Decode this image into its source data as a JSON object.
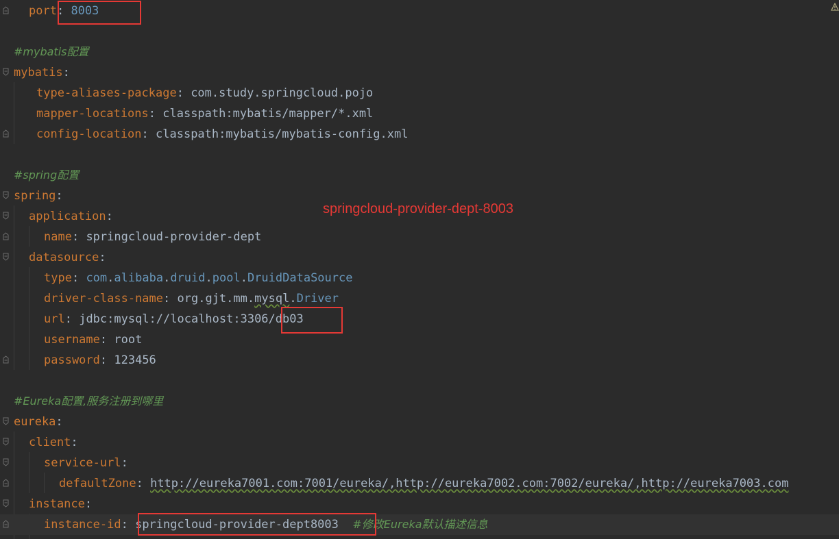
{
  "lines": [
    {
      "key": "port",
      "value": "8003"
    },
    {
      "comment": "#mybatis配置"
    },
    {
      "key": "mybatis"
    },
    {
      "key": "type-aliases-package",
      "value": "com.study.springcloud.pojo"
    },
    {
      "key": "mapper-locations",
      "value": "classpath:mybatis/mapper/*.xml"
    },
    {
      "key": "config-location",
      "value": "classpath:mybatis/mybatis-config.xml"
    },
    {
      "comment": "#spring配置"
    },
    {
      "key": "spring"
    },
    {
      "key": "application"
    },
    {
      "key": "name",
      "value": "springcloud-provider-dept"
    },
    {
      "key": "datasource"
    },
    {
      "key": "type",
      "value_parts": [
        "com",
        "alibaba",
        "druid",
        "pool",
        "DruidDataSource"
      ]
    },
    {
      "key": "driver-class-name",
      "value_parts": [
        "org",
        "gjt",
        "mm",
        "mysql",
        "Driver"
      ]
    },
    {
      "key": "url",
      "value": "jdbc:mysql://localhost:3306/db03"
    },
    {
      "key": "username",
      "value": "root"
    },
    {
      "key": "password",
      "value": "123456"
    },
    {
      "comment": "#Eureka配置,服务注册到哪里"
    },
    {
      "key": "eureka"
    },
    {
      "key": "client"
    },
    {
      "key": "service-url"
    },
    {
      "key": "defaultZone",
      "value": "http://eureka7001.com:7001/eureka/,http://eureka7002.com:7002/eureka/,http://eureka7003.com"
    },
    {
      "key": "instance"
    },
    {
      "key": "instance-id",
      "value": "springcloud-provider-dept8003",
      "trailing_comment": "#修改Eureka默认描述信息"
    }
  ],
  "annotation": "springcloud-provider-dept-8003",
  "colors": {
    "background": "#2b2b2b",
    "key": "#cc7832",
    "comment": "#629755",
    "text": "#a9b7c6",
    "class": "#6897bb",
    "highlight": "#e53935"
  },
  "icons": {
    "fold": "fold-marker-icon",
    "warning": "warning-icon"
  }
}
